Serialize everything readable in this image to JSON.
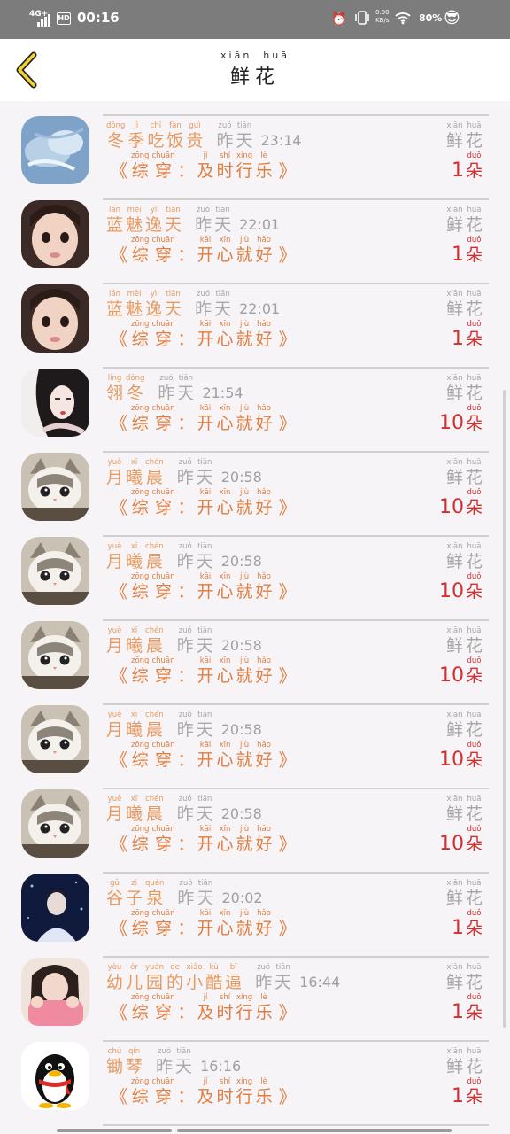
{
  "status_bar": {
    "network": "4G+",
    "hd": "HD",
    "time": "00:16",
    "speed": "0.00",
    "speed_unit": "KB/s",
    "battery": "80%"
  },
  "header": {
    "title_pinyin": [
      "xiān",
      "huā"
    ],
    "title": [
      "鲜",
      "花"
    ]
  },
  "labels": {
    "flower_pinyin": [
      "xiān",
      "huā"
    ],
    "flower": [
      "鲜",
      "花"
    ],
    "unit_pinyin": "duǒ",
    "unit": "朵",
    "yesterday_pinyin": [
      "zuó",
      "tiān"
    ],
    "yesterday": [
      "昨",
      "天"
    ],
    "quote_open": "《",
    "quote_close": "》"
  },
  "rows": [
    {
      "avatar": "ice",
      "name": [],
      "name_pinyin": [],
      "time": "",
      "gift": [
        "综",
        "穿",
        "：",
        "及",
        "时",
        "行",
        "乐"
      ],
      "gift_pinyin": [
        "zōng",
        "chuān",
        "",
        "jí",
        "shí",
        "xíng",
        "lè"
      ],
      "count": "1",
      "partial": true
    },
    {
      "avatar": "ice",
      "name": [
        "冬",
        "季",
        "吃",
        "饭",
        "贵"
      ],
      "name_pinyin": [
        "dōng",
        "jì",
        "chī",
        "fàn",
        "guì"
      ],
      "time": "23:14",
      "gift": [
        "综",
        "穿",
        "：",
        "及",
        "时",
        "行",
        "乐"
      ],
      "gift_pinyin": [
        "zōng",
        "chuān",
        "",
        "jí",
        "shí",
        "xíng",
        "lè"
      ],
      "count": "1"
    },
    {
      "avatar": "girl",
      "name": [
        "蓝",
        "魅",
        "逸",
        "天"
      ],
      "name_pinyin": [
        "lán",
        "mèi",
        "yì",
        "tiān"
      ],
      "time": "22:01",
      "gift": [
        "综",
        "穿",
        "：",
        "开",
        "心",
        "就",
        "好"
      ],
      "gift_pinyin": [
        "zōng",
        "chuān",
        "",
        "kāi",
        "xīn",
        "jiù",
        "hǎo"
      ],
      "count": "1"
    },
    {
      "avatar": "girl",
      "name": [
        "蓝",
        "魅",
        "逸",
        "天"
      ],
      "name_pinyin": [
        "lán",
        "mèi",
        "yì",
        "tiān"
      ],
      "time": "22:01",
      "gift": [
        "综",
        "穿",
        "：",
        "开",
        "心",
        "就",
        "好"
      ],
      "gift_pinyin": [
        "zōng",
        "chuān",
        "",
        "kāi",
        "xīn",
        "jiù",
        "hǎo"
      ],
      "count": "1"
    },
    {
      "avatar": "art",
      "name": [
        "翎",
        "冬"
      ],
      "name_pinyin": [
        "líng",
        "dōng"
      ],
      "time": "21:54",
      "gift": [
        "综",
        "穿",
        "：",
        "开",
        "心",
        "就",
        "好"
      ],
      "gift_pinyin": [
        "zōng",
        "chuān",
        "",
        "kāi",
        "xīn",
        "jiù",
        "hǎo"
      ],
      "count": "10"
    },
    {
      "avatar": "cat",
      "name": [
        "月",
        "曦",
        "晨"
      ],
      "name_pinyin": [
        "yuè",
        "xī",
        "chén"
      ],
      "time": "20:58",
      "gift": [
        "综",
        "穿",
        "：",
        "开",
        "心",
        "就",
        "好"
      ],
      "gift_pinyin": [
        "zōng",
        "chuān",
        "",
        "kāi",
        "xīn",
        "jiù",
        "hǎo"
      ],
      "count": "10"
    },
    {
      "avatar": "cat",
      "name": [
        "月",
        "曦",
        "晨"
      ],
      "name_pinyin": [
        "yuè",
        "xī",
        "chén"
      ],
      "time": "20:58",
      "gift": [
        "综",
        "穿",
        "：",
        "开",
        "心",
        "就",
        "好"
      ],
      "gift_pinyin": [
        "zōng",
        "chuān",
        "",
        "kāi",
        "xīn",
        "jiù",
        "hǎo"
      ],
      "count": "10"
    },
    {
      "avatar": "cat",
      "name": [
        "月",
        "曦",
        "晨"
      ],
      "name_pinyin": [
        "yuè",
        "xī",
        "chén"
      ],
      "time": "20:58",
      "gift": [
        "综",
        "穿",
        "：",
        "开",
        "心",
        "就",
        "好"
      ],
      "gift_pinyin": [
        "zōng",
        "chuān",
        "",
        "kāi",
        "xīn",
        "jiù",
        "hǎo"
      ],
      "count": "10"
    },
    {
      "avatar": "cat",
      "name": [
        "月",
        "曦",
        "晨"
      ],
      "name_pinyin": [
        "yuè",
        "xī",
        "chén"
      ],
      "time": "20:58",
      "gift": [
        "综",
        "穿",
        "：",
        "开",
        "心",
        "就",
        "好"
      ],
      "gift_pinyin": [
        "zōng",
        "chuān",
        "",
        "kāi",
        "xīn",
        "jiù",
        "hǎo"
      ],
      "count": "10"
    },
    {
      "avatar": "cat",
      "name": [
        "月",
        "曦",
        "晨"
      ],
      "name_pinyin": [
        "yuè",
        "xī",
        "chén"
      ],
      "time": "20:58",
      "gift": [
        "综",
        "穿",
        "：",
        "开",
        "心",
        "就",
        "好"
      ],
      "gift_pinyin": [
        "zōng",
        "chuān",
        "",
        "kāi",
        "xīn",
        "jiù",
        "hǎo"
      ],
      "count": "10"
    },
    {
      "avatar": "night",
      "name": [
        "谷",
        "子",
        "泉"
      ],
      "name_pinyin": [
        "gǔ",
        "zi",
        "quán"
      ],
      "time": "20:02",
      "gift": [
        "综",
        "穿",
        "：",
        "开",
        "心",
        "就",
        "好"
      ],
      "gift_pinyin": [
        "zōng",
        "chuān",
        "",
        "kāi",
        "xīn",
        "jiù",
        "hǎo"
      ],
      "count": "1"
    },
    {
      "avatar": "pink",
      "name": [
        "幼",
        "儿",
        "园",
        "的",
        "小",
        "酷",
        "逼"
      ],
      "name_pinyin": [
        "yòu",
        "ér",
        "yuán",
        "de",
        "xiǎo",
        "kù",
        "bī"
      ],
      "time": "16:44",
      "gift": [
        "综",
        "穿",
        "：",
        "及",
        "时",
        "行",
        "乐"
      ],
      "gift_pinyin": [
        "zōng",
        "chuān",
        "",
        "jí",
        "shí",
        "xíng",
        "lè"
      ],
      "count": "1"
    },
    {
      "avatar": "penguin",
      "name": [
        "锄",
        "琴"
      ],
      "name_pinyin": [
        "chú",
        "qín"
      ],
      "time": "16:16",
      "gift": [
        "综",
        "穿",
        "：",
        "及",
        "时",
        "行",
        "乐"
      ],
      "gift_pinyin": [
        "zōng",
        "chuān",
        "",
        "jí",
        "shí",
        "xíng",
        "lè"
      ],
      "count": "1"
    }
  ]
}
